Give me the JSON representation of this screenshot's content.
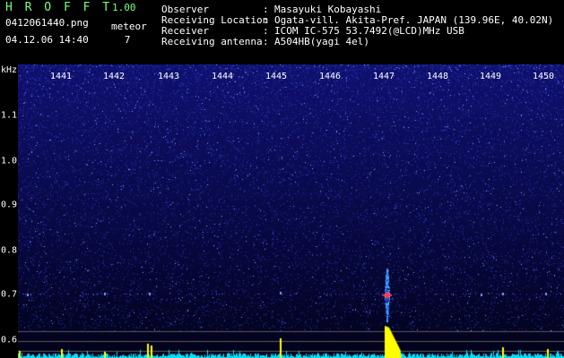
{
  "header": {
    "app_title": "H R O F F T",
    "version": "1.00",
    "filename": "0412061440.png",
    "datetime": "04.12.06 14:40",
    "meteor_label": "meteor",
    "meteor_count": "7",
    "info": [
      {
        "label": "Observer",
        "value": "Masayuki Kobayashi"
      },
      {
        "label": "Receiving Location",
        "value": "Ogata-vill. Akita-Pref. JAPAN (139.96E, 40.02N)"
      },
      {
        "label": "Receiver",
        "value": "ICOM IC-575 53.7492(@LCD)MHz USB"
      },
      {
        "label": "Receiving antenna",
        "value": "A504HB(yagi 4el)"
      }
    ],
    "separator": ":"
  },
  "spectrogram": {
    "y_unit": "kHz",
    "time_ticks": [
      "1441",
      "1442",
      "1443",
      "1444",
      "1445",
      "1446",
      "1447",
      "1448",
      "1449",
      "1450"
    ],
    "freq_ticks": [
      "1.1",
      "1.0",
      "0.9",
      "0.8",
      "0.7",
      "0.6"
    ],
    "colors": {
      "background": "#0a0a50",
      "noise": "#2a3dc8",
      "echo_core": "#ff3060",
      "echo_halo": "#40c0ff",
      "level": "#ffff00",
      "baseline": "#00e0ff"
    }
  }
}
